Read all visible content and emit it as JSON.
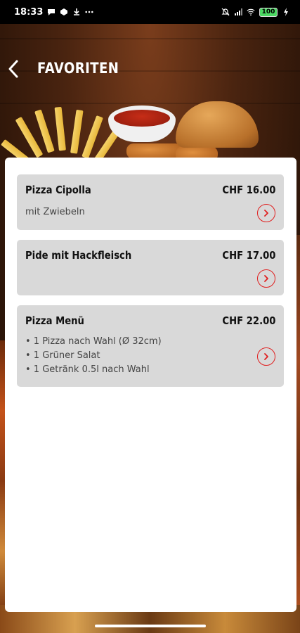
{
  "status_bar": {
    "time": "18:33",
    "battery": "100"
  },
  "header": {
    "title": "FAVORITEN"
  },
  "items": [
    {
      "name": "Pizza Cipolla",
      "price": "CHF 16.00",
      "description": "mit Zwiebeln"
    },
    {
      "name": "Pide mit Hackfleisch",
      "price": "CHF 17.00"
    },
    {
      "name": "Pizza Menü",
      "price": "CHF 22.00",
      "lines": [
        "• 1 Pizza nach Wahl (Ø 32cm)",
        "• 1 Grüner Salat",
        "• 1 Getränk 0.5l nach Wahl"
      ]
    }
  ],
  "colors": {
    "accent": "#e02020",
    "card_bg": "#d9d9d9"
  }
}
